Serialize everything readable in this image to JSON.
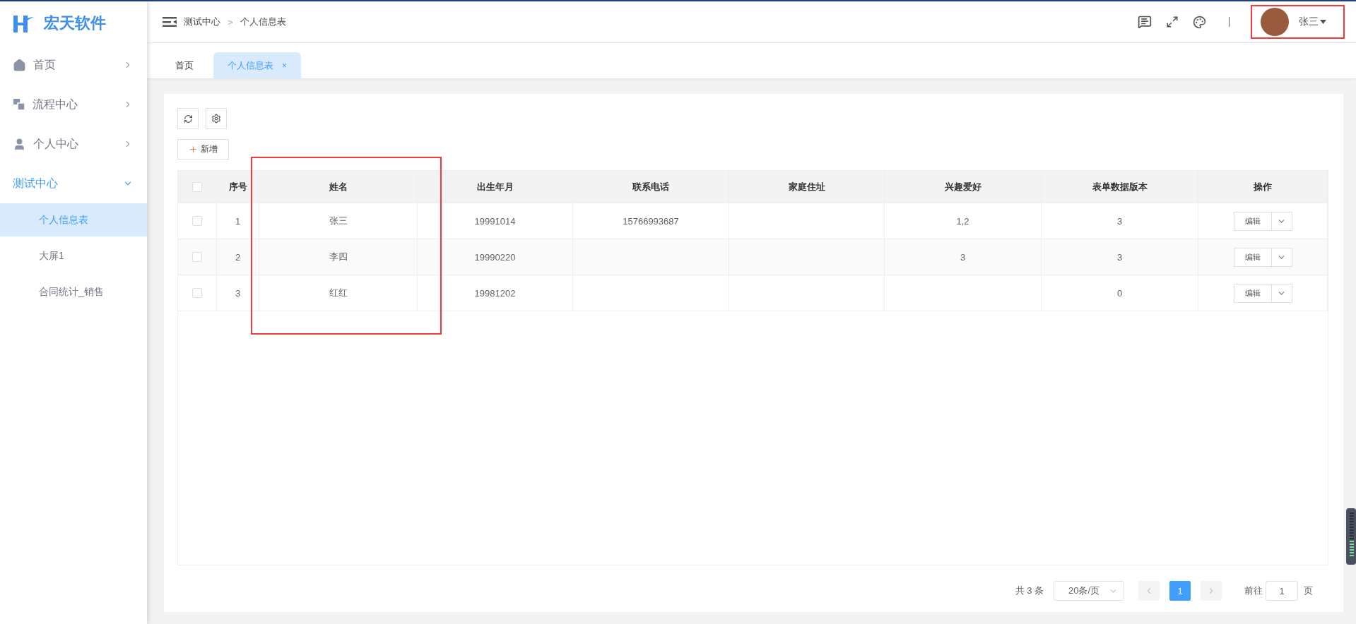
{
  "logo": {
    "text": "宏天软件"
  },
  "sidebar": {
    "items": [
      {
        "label": "首页",
        "expanded": false
      },
      {
        "label": "流程中心",
        "expanded": false
      },
      {
        "label": "个人中心",
        "expanded": false
      },
      {
        "label": "测试中心",
        "expanded": true,
        "children": [
          {
            "label": "个人信息表",
            "selected": true
          },
          {
            "label": "大屏1",
            "selected": false
          },
          {
            "label": "合同统计_销售",
            "selected": false
          }
        ]
      }
    ]
  },
  "breadcrumb": {
    "items": [
      "测试中心",
      "个人信息表"
    ],
    "separator": ">"
  },
  "user": {
    "name": "张三"
  },
  "tabs": [
    {
      "label": "首页",
      "selected": false
    },
    {
      "label": "个人信息表",
      "selected": true,
      "close": "×"
    }
  ],
  "add_button": {
    "label": "新增"
  },
  "table": {
    "header_checked": false,
    "columns": [
      "序号",
      "姓名",
      "出生年月",
      "联系电话",
      "家庭住址",
      "兴趣爱好",
      "表单数据版本",
      "操作"
    ],
    "rows": [
      {
        "checked": false,
        "cells": [
          "1",
          "张三",
          "19991014",
          "15766993687",
          "",
          "1,2",
          "3"
        ],
        "action": "编辑"
      },
      {
        "checked": false,
        "cells": [
          "2",
          "李四",
          "19990220",
          "",
          "",
          "3",
          "3"
        ],
        "action": "编辑"
      },
      {
        "checked": false,
        "cells": [
          "3",
          "红红",
          "19981202",
          "",
          "",
          "",
          "0"
        ],
        "action": "编辑"
      }
    ]
  },
  "pagination": {
    "total": "共 3 条",
    "page_size": "20条/页",
    "pages": [
      {
        "label": "1",
        "selected": true
      }
    ],
    "goto_label": "前往",
    "goto_value": "1",
    "goto_suffix": "页"
  }
}
